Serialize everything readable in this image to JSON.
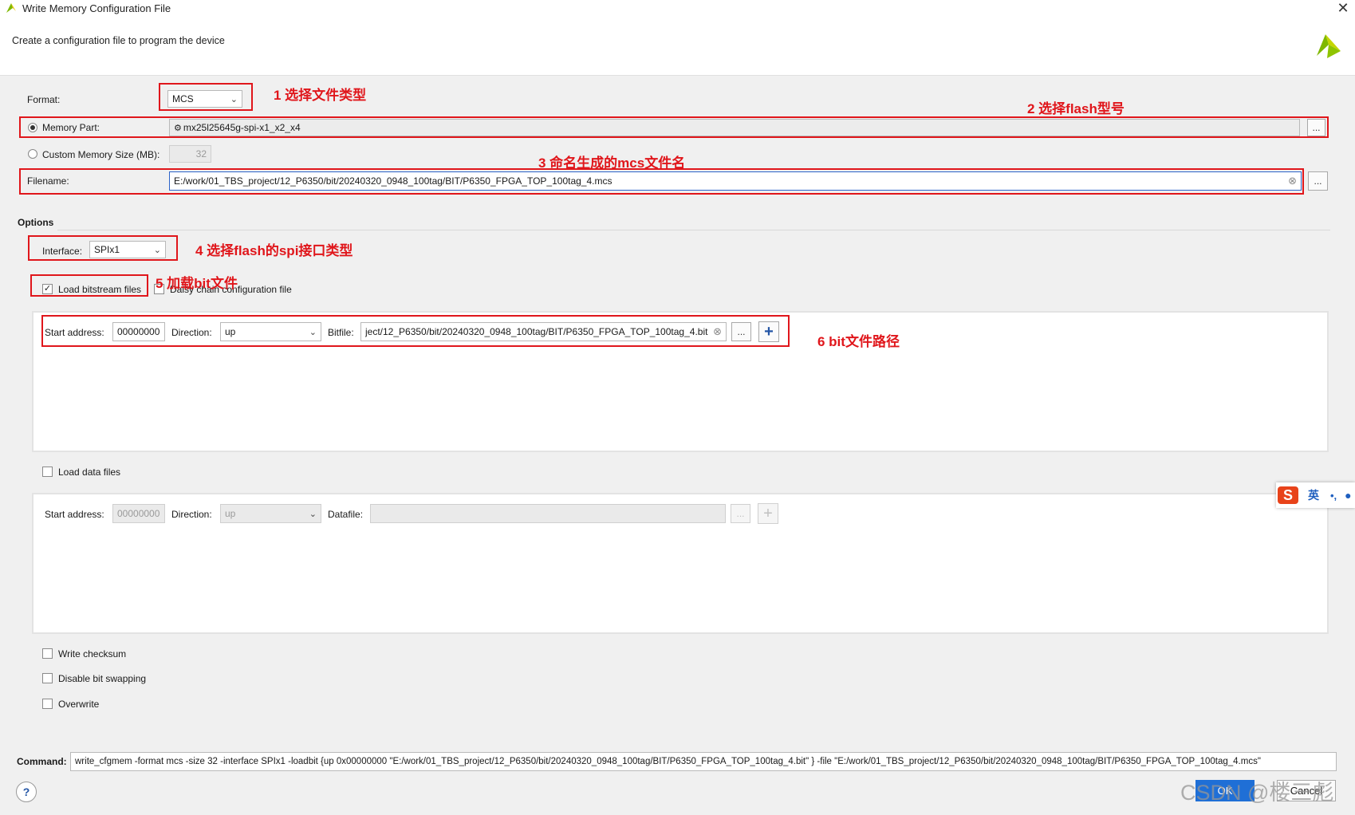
{
  "window": {
    "title": "Write Memory Configuration File",
    "close_glyph": "✕",
    "subtitle": "Create a configuration file to program the device"
  },
  "format": {
    "label": "Format:",
    "value": "MCS"
  },
  "memory_part": {
    "label": "Memory Part:",
    "value": "mx25l25645g-spi-x1_x2_x4",
    "selected": true,
    "browse_label": "..."
  },
  "custom_memory": {
    "label": "Custom Memory Size (MB):",
    "value": "32",
    "selected": false
  },
  "filename": {
    "label": "Filename:",
    "value": "E:/work/01_TBS_project/12_P6350/bit/20240320_0948_100tag/BIT/P6350_FPGA_TOP_100tag_4.mcs",
    "browse_label": "..."
  },
  "options": {
    "section_label": "Options",
    "interface_label": "Interface:",
    "interface_value": "SPIx1",
    "load_bitstream_label": "Load bitstream files",
    "load_bitstream_checked": true,
    "daisy_chain_label": "Daisy chain configuration file",
    "daisy_chain_checked": false
  },
  "bitstream_row": {
    "start_address_label": "Start address:",
    "start_address": "00000000",
    "direction_label": "Direction:",
    "direction": "up",
    "bitfile_label": "Bitfile:",
    "bitfile": "ject/12_P6350/bit/20240320_0948_100tag/BIT/P6350_FPGA_TOP_100tag_4.bit",
    "browse_label": "...",
    "add_label": "+"
  },
  "load_data": {
    "label": "Load data files",
    "checked": false
  },
  "data_row": {
    "start_address_label": "Start address:",
    "start_address": "00000000",
    "direction_label": "Direction:",
    "direction": "up",
    "datafile_label": "Datafile:",
    "datafile": "",
    "browse_label": "...",
    "add_label": "+"
  },
  "checkboxes": [
    {
      "label": "Write checksum",
      "checked": false
    },
    {
      "label": "Disable bit swapping",
      "checked": false
    },
    {
      "label": "Overwrite",
      "checked": false
    }
  ],
  "command": {
    "label": "Command:",
    "value": "write_cfgmem  -format mcs -size 32 -interface SPIx1 -loadbit {up 0x00000000 \"E:/work/01_TBS_project/12_P6350/bit/20240320_0948_100tag/BIT/P6350_FPGA_TOP_100tag_4.bit\" } -file \"E:/work/01_TBS_project/12_P6350/bit/20240320_0948_100tag/BIT/P6350_FPGA_TOP_100tag_4.mcs\""
  },
  "footer": {
    "help_glyph": "?",
    "ok_label": "OK",
    "cancel_label": "Cancel"
  },
  "annotations": [
    "1 选择文件类型",
    "2 选择flash型号",
    "3 命名生成的mcs文件名",
    "4 选择flash的spi接口类型",
    "5 加载bit文件",
    "6 bit文件路径"
  ],
  "watermark": "CSDN @楼三彪",
  "ime": {
    "mode_label": "英",
    "punct": "•,"
  },
  "colors": {
    "annotation_red": "#e0161b",
    "accent_blue": "#2456a6",
    "ok_blue": "#1f6fd6"
  }
}
